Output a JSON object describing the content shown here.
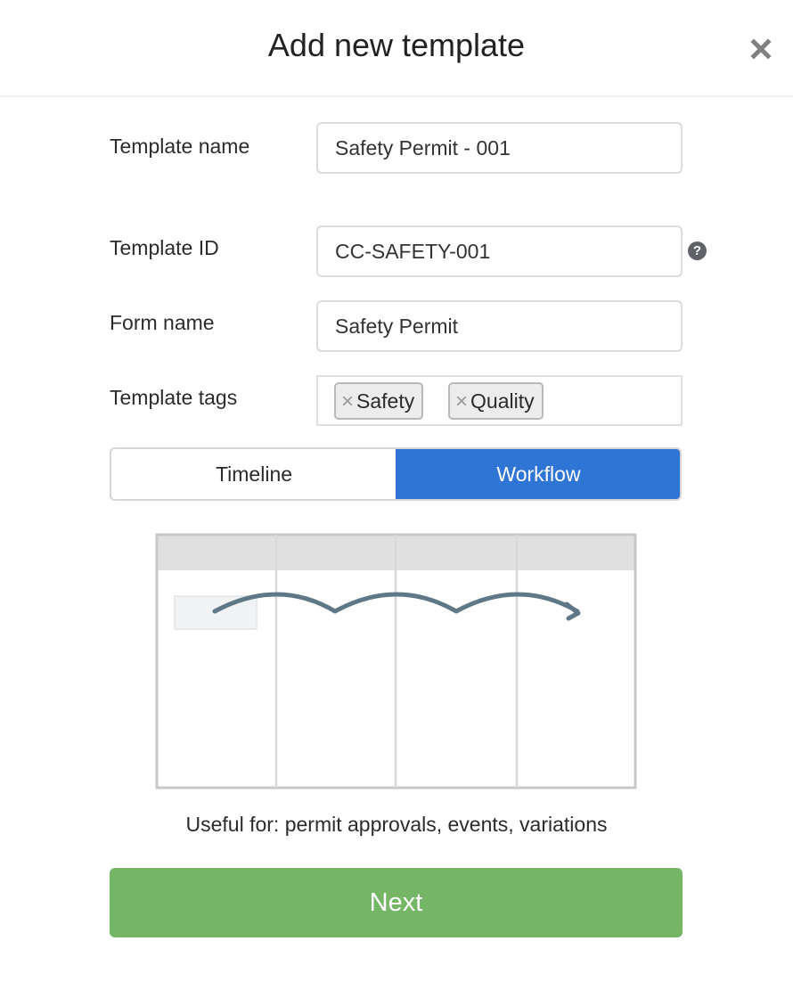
{
  "dialog": {
    "title": "Add new template",
    "close_icon": "close-icon"
  },
  "form": {
    "template_name": {
      "label": "Template name",
      "value": "Safety Permit - 001"
    },
    "template_id": {
      "label": "Template ID",
      "value": "CC-SAFETY-001",
      "help_icon": "question-circle-icon",
      "help_glyph": "?"
    },
    "form_name": {
      "label": "Form name",
      "value": "Safety Permit"
    },
    "template_tags": {
      "label": "Template tags",
      "remove_glyph": "×",
      "tags": [
        "Safety",
        "Quality"
      ]
    }
  },
  "type_toggle": {
    "options": [
      "Timeline",
      "Workflow"
    ],
    "selected": "Workflow"
  },
  "preview": {
    "illustration": "workflow-diagram",
    "columns": 4
  },
  "description": "Useful for: permit approvals, events, variations",
  "next_label": "Next",
  "colors": {
    "accent_blue": "#2f75d6",
    "next_green": "#74b566",
    "arrow": "#5f7887"
  }
}
